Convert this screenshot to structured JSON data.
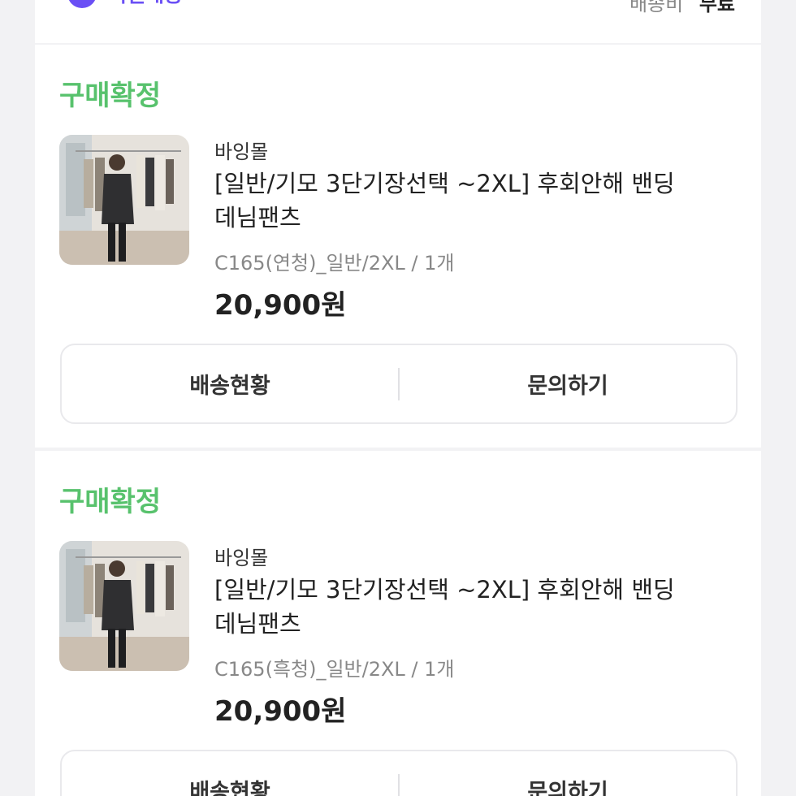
{
  "top_bar": {
    "badge_icon": "check-circle-icon",
    "badge_label": "익일배송",
    "shipping_label": "배송비",
    "shipping_value": "무료"
  },
  "orders": [
    {
      "status": "구매확정",
      "seller": "바잉몰",
      "title_line1": "[일반/기모 3단기장선택 ~2XL] 후회안해 밴딩",
      "title_line2": "데님팬츠",
      "option": "C165(연청)_일반/2XL / 1개",
      "price": "20,900원",
      "actions": [
        "배송현황",
        "문의하기"
      ]
    },
    {
      "status": "구매확정",
      "seller": "바잉몰",
      "title_line1": "[일반/기모 3단기장선택 ~2XL] 후회안해 밴딩",
      "title_line2": "데님팬츠",
      "option": "C165(흑청)_일반/2XL / 1개",
      "price": "20,900원",
      "actions": [
        "배송현황",
        "문의하기"
      ]
    }
  ],
  "colors": {
    "status_green": "#58c26d",
    "badge_purple": "#6a4ff5",
    "background": "#f2f2f4"
  }
}
